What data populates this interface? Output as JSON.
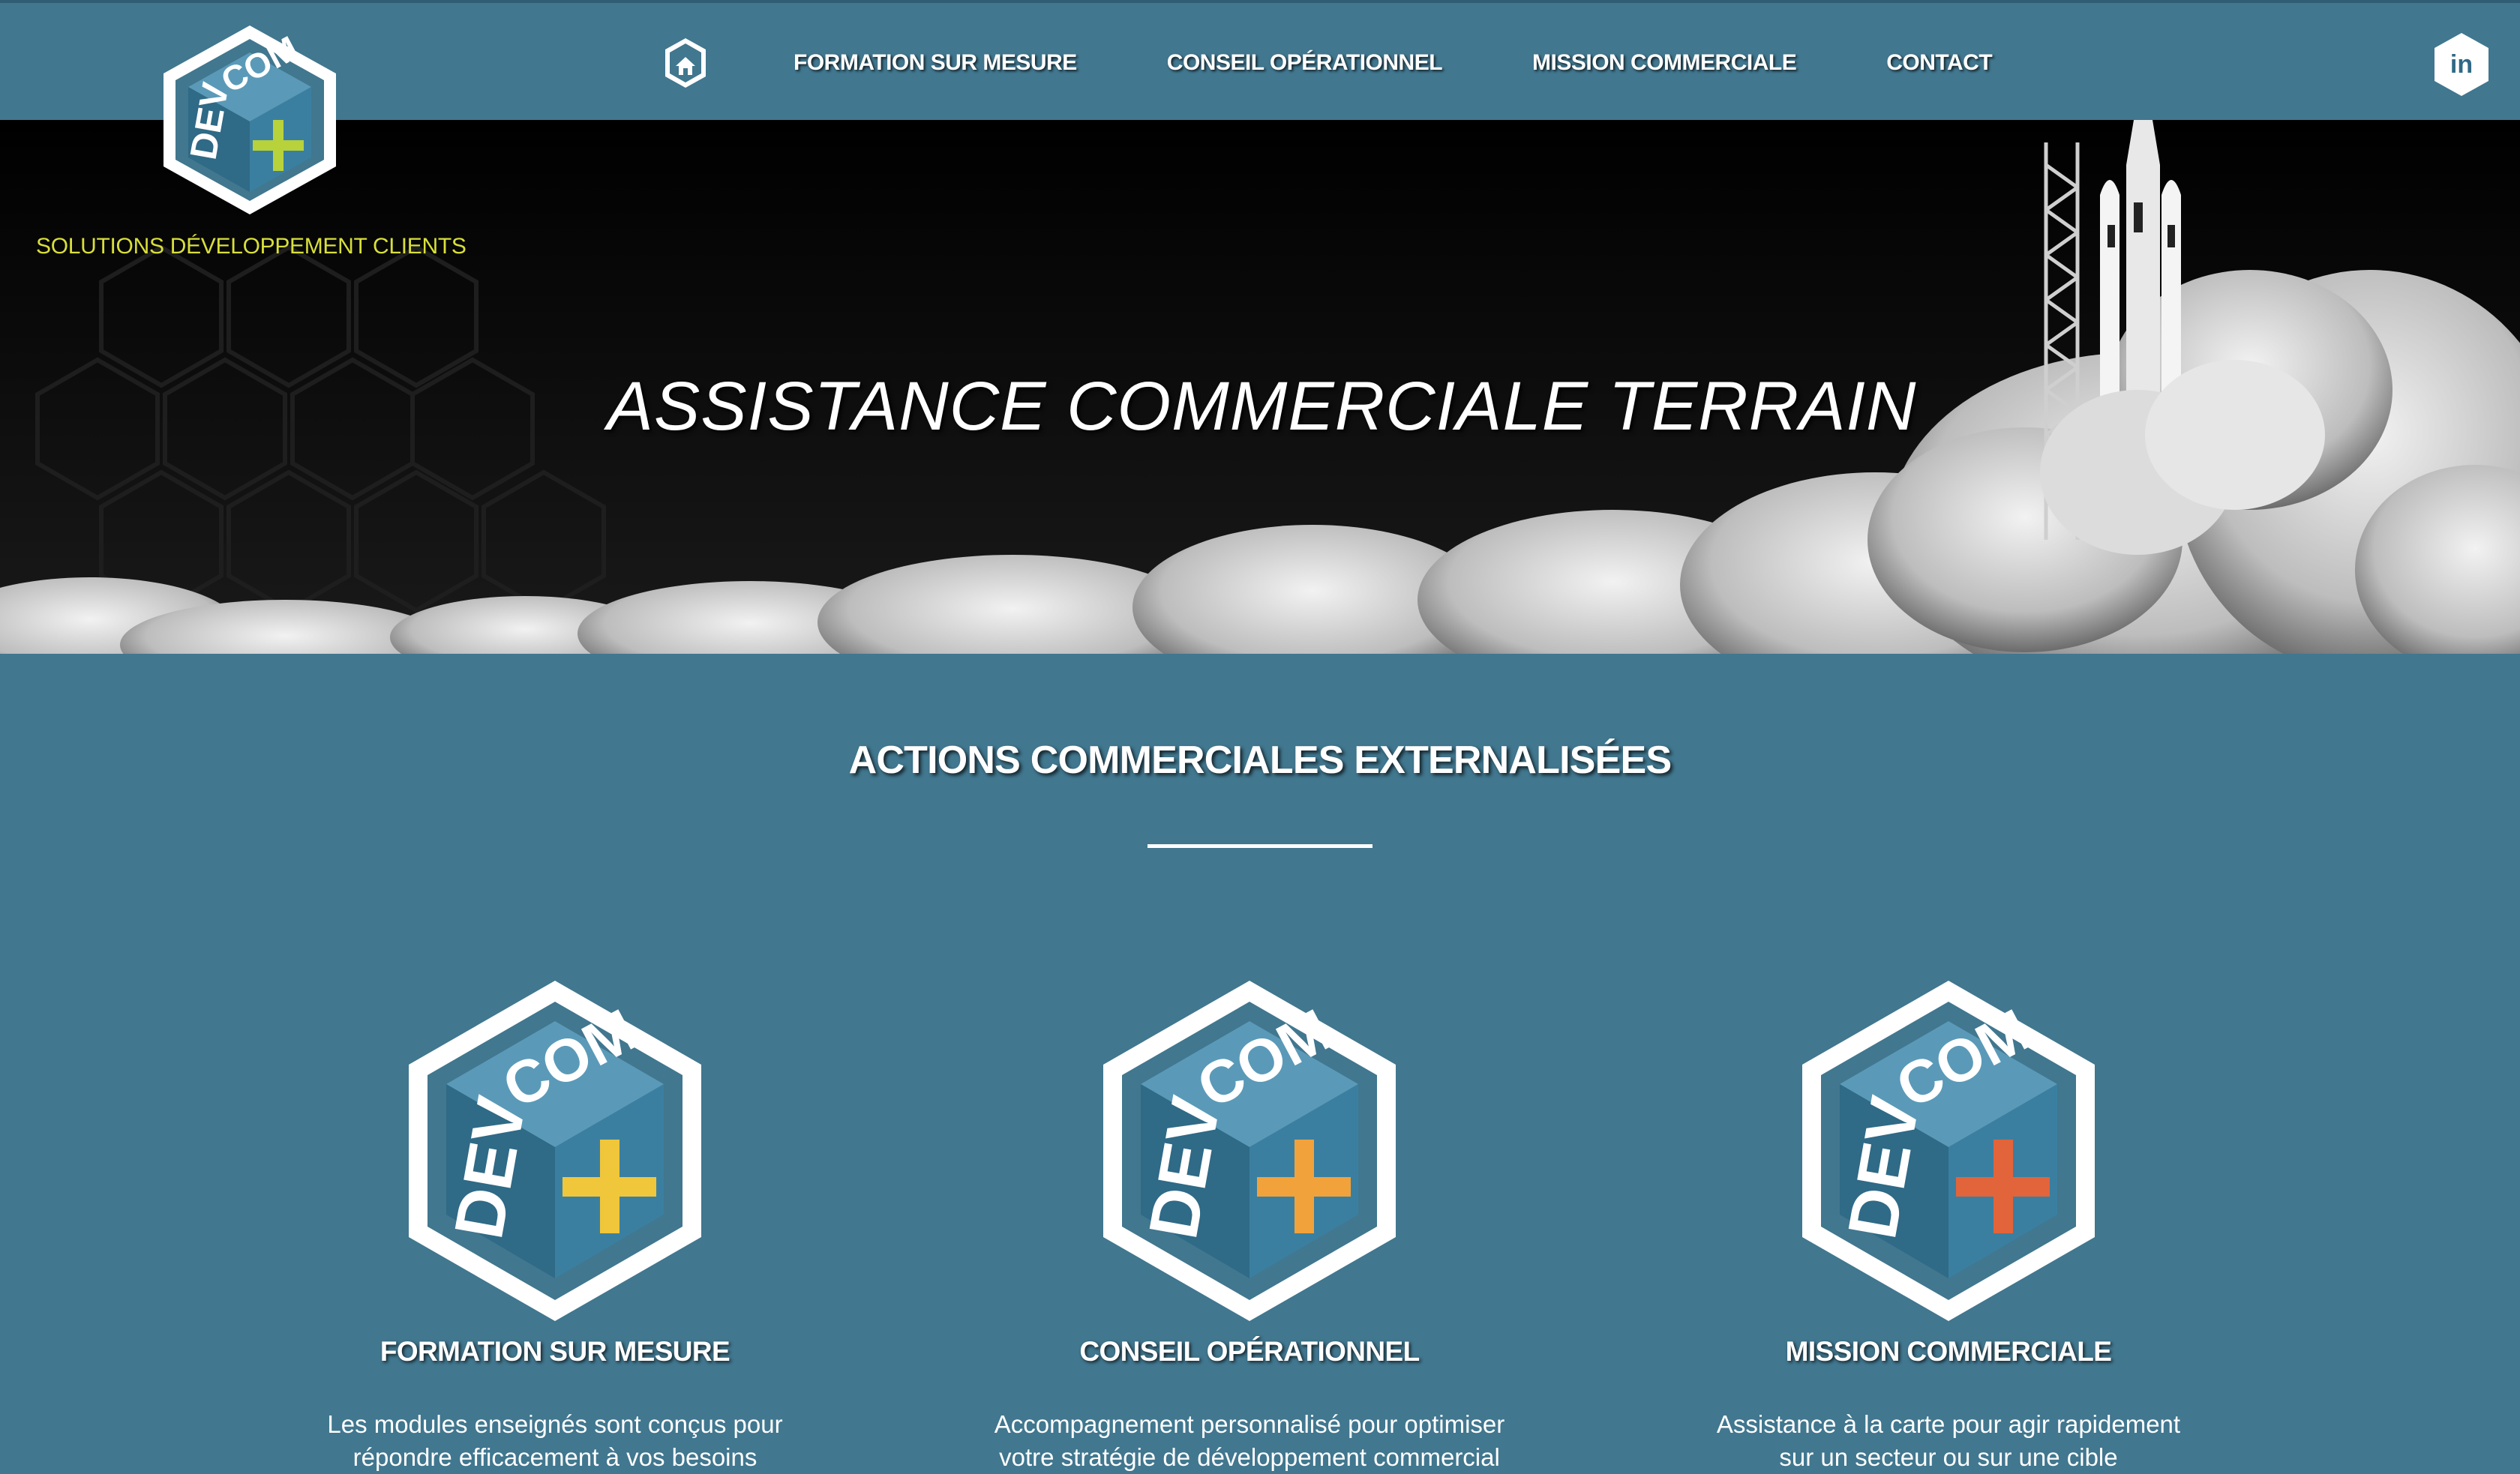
{
  "brand": {
    "logo_text_dev": "DEV",
    "logo_text_com": "COM",
    "tagline": "SOLUTIONS DÉVELOPPEMENT CLIENTS"
  },
  "nav": {
    "items": [
      "FORMATION SUR MESURE",
      "CONSEIL OPÉRATIONNEL",
      "MISSION COMMERCIALE",
      "CONTACT"
    ],
    "linkedin_label": "in"
  },
  "hero": {
    "title": "ASSISTANCE COMMERCIALE TERRAIN"
  },
  "section": {
    "title": "ACTIONS COMMERCIALES EXTERNALISÉES"
  },
  "cards": [
    {
      "title": "FORMATION SUR MESURE",
      "desc_line1": "Les modules enseignés sont conçus pour",
      "desc_line2": "répondre efficacement à vos besoins",
      "plus_color": "#f0c63a"
    },
    {
      "title": "CONSEIL OPÉRATIONNEL",
      "desc_line1": "Accompagnement personnalisé pour optimiser",
      "desc_line2": "votre stratégie de développement commercial",
      "plus_color": "#f2a23a"
    },
    {
      "title": "MISSION COMMERCIALE",
      "desc_line1": "Assistance à la carte pour agir rapidement",
      "desc_line2": "sur un secteur ou sur une cible",
      "plus_color": "#e2643a"
    }
  ],
  "colors": {
    "page_bg": "#41778f",
    "hero_bg": "#000000",
    "tagline": "#d8df3a",
    "logo_plus": "#b7d23a",
    "cube_top": "#5a9ab8",
    "cube_left": "#2f6a86",
    "cube_right": "#3b7fa0"
  }
}
